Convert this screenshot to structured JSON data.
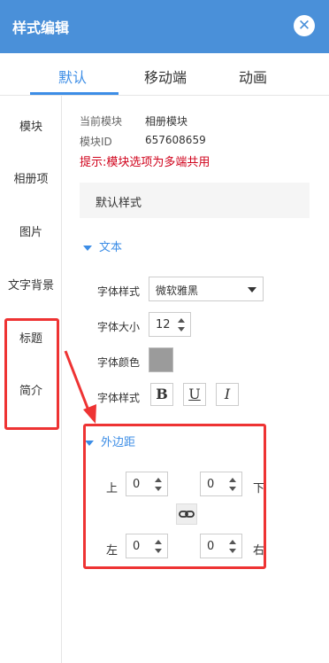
{
  "header": {
    "title": "样式编辑"
  },
  "tabs": [
    {
      "label": "默认"
    },
    {
      "label": "移动端"
    },
    {
      "label": "动画"
    }
  ],
  "sidebar": {
    "items": [
      {
        "label": "模块"
      },
      {
        "label": "相册项"
      },
      {
        "label": "图片"
      },
      {
        "label": "文字背景"
      },
      {
        "label": "标题"
      },
      {
        "label": "简介"
      }
    ]
  },
  "meta": {
    "current_module_label": "当前模块",
    "current_module_value": "相册模块",
    "module_id_label": "模块ID",
    "module_id_value": "657608659",
    "tip": "提示:模块选项为多端共用"
  },
  "default_style": "默认样式",
  "text_section": {
    "title": "文本",
    "font_family_label": "字体样式",
    "font_family_value": "微软雅黑",
    "font_size_label": "字体大小",
    "font_size_value": "12",
    "font_color_label": "字体颜色",
    "font_color_value": "#9b9b9b",
    "font_style_label": "字体样式",
    "bold": "B",
    "underline": "U",
    "italic": "I"
  },
  "margin_section": {
    "title": "外边距",
    "top_label": "上",
    "top_value": "0",
    "bottom_label": "下",
    "bottom_value": "0",
    "left_label": "左",
    "left_value": "0",
    "right_label": "右",
    "right_value": "0"
  },
  "colors": {
    "header": "#4a90d9",
    "accent": "#3c8de6",
    "tip": "#d0021b",
    "highlight": "#e33"
  }
}
